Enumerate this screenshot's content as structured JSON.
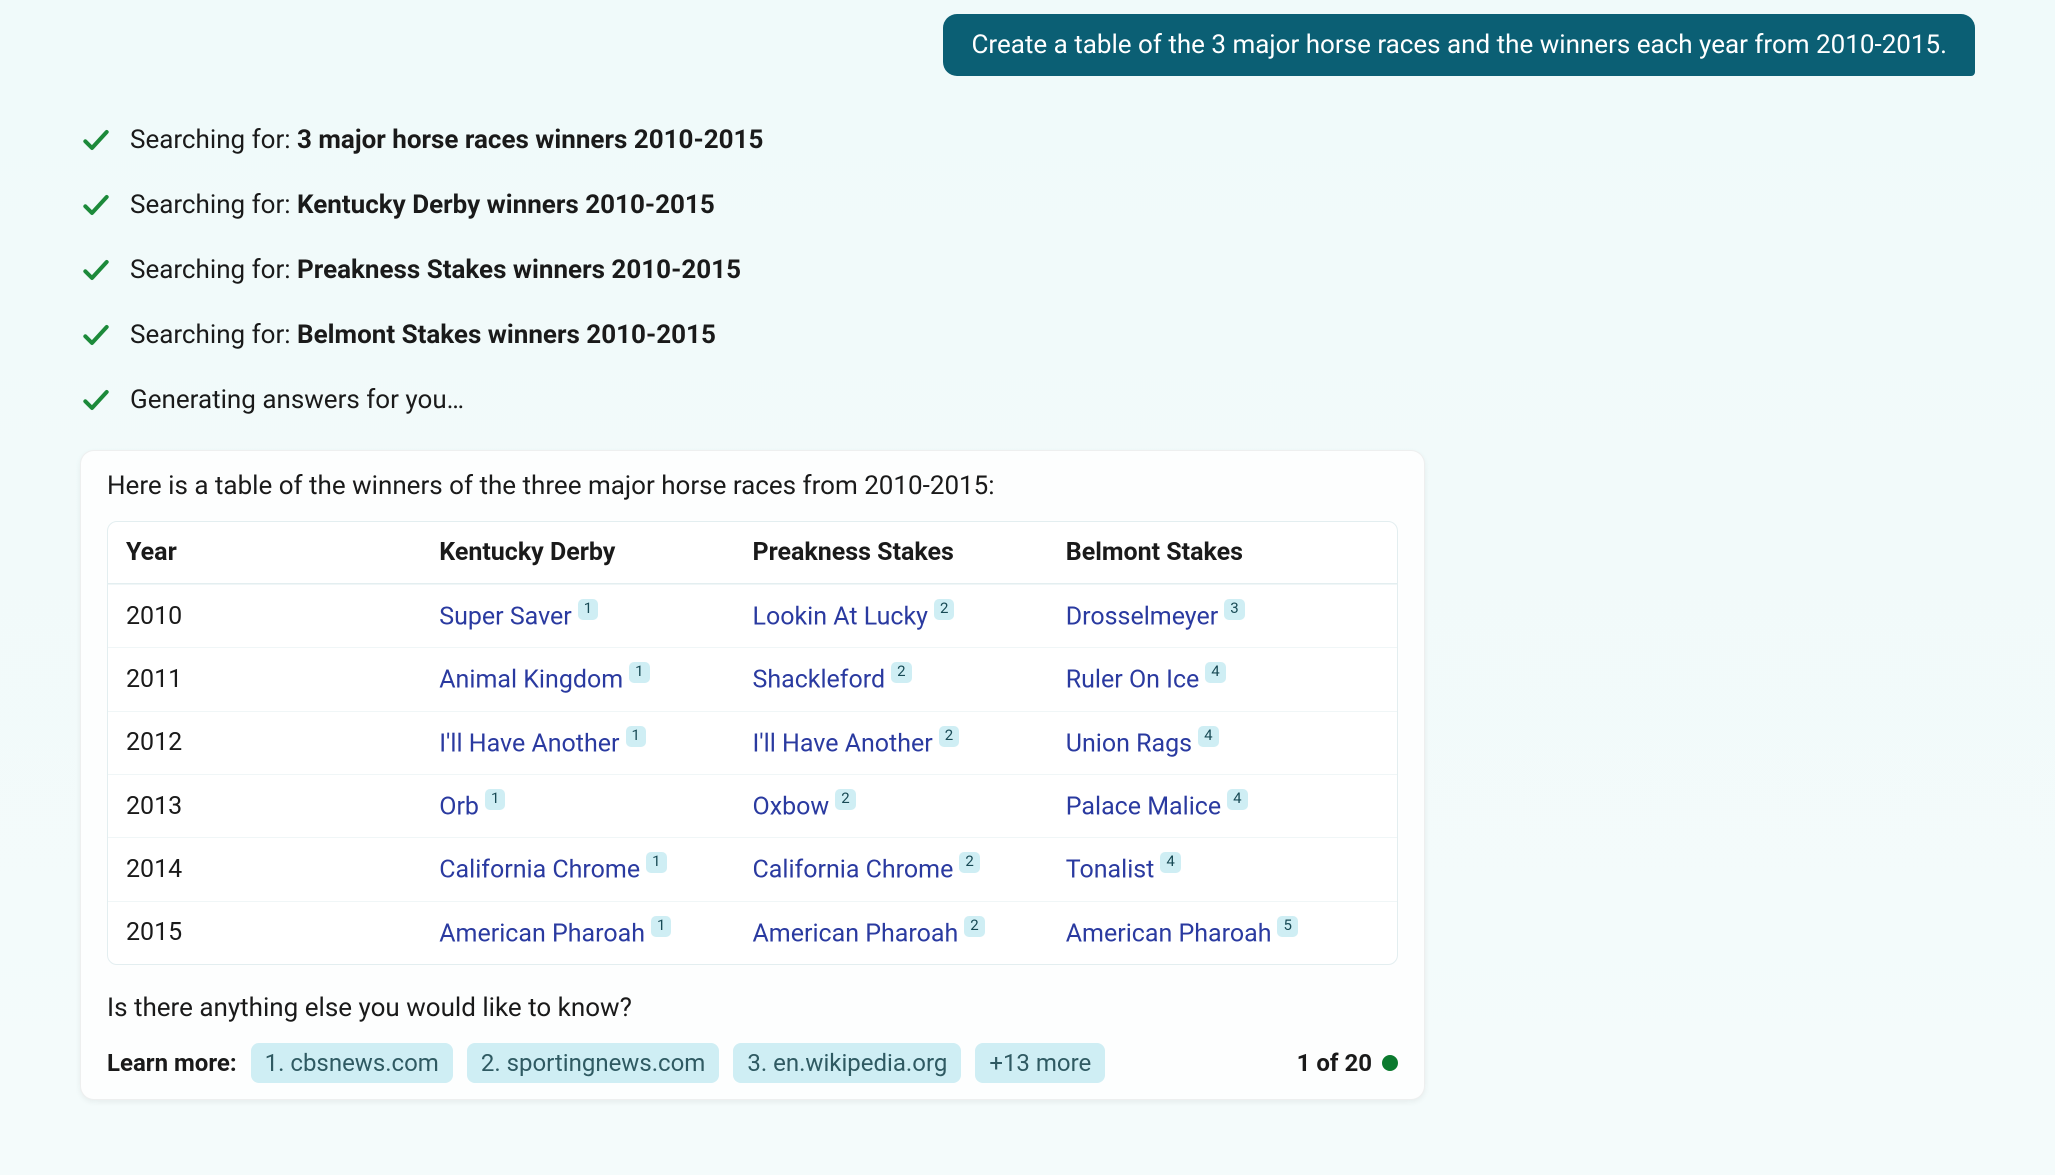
{
  "user_prompt": "Create a table of the 3 major horse races and the winners each year from 2010-2015.",
  "steps": [
    {
      "prefix": "Searching for: ",
      "query": "3 major horse races winners 2010-2015"
    },
    {
      "prefix": "Searching for: ",
      "query": "Kentucky Derby winners 2010-2015"
    },
    {
      "prefix": "Searching for: ",
      "query": "Preakness Stakes winners 2010-2015"
    },
    {
      "prefix": "Searching for: ",
      "query": "Belmont Stakes winners 2010-2015"
    },
    {
      "prefix": "",
      "query": "Generating answers for you…"
    }
  ],
  "answer_intro": "Here is a table of the winners of the three major horse races from 2010-2015:",
  "table": {
    "headers": [
      "Year",
      "Kentucky Derby",
      "Preakness Stakes",
      "Belmont Stakes"
    ],
    "rows": [
      {
        "year": "2010",
        "kd": {
          "name": "Super Saver",
          "cite": "1"
        },
        "ps": {
          "name": "Lookin At Lucky",
          "cite": "2"
        },
        "bs": {
          "name": "Drosselmeyer",
          "cite": "3"
        }
      },
      {
        "year": "2011",
        "kd": {
          "name": "Animal Kingdom",
          "cite": "1"
        },
        "ps": {
          "name": "Shackleford",
          "cite": "2"
        },
        "bs": {
          "name": "Ruler On Ice",
          "cite": "4"
        }
      },
      {
        "year": "2012",
        "kd": {
          "name": "I'll Have Another",
          "cite": "1"
        },
        "ps": {
          "name": "I'll Have Another",
          "cite": "2"
        },
        "bs": {
          "name": "Union Rags",
          "cite": "4"
        }
      },
      {
        "year": "2013",
        "kd": {
          "name": "Orb",
          "cite": "1"
        },
        "ps": {
          "name": "Oxbow",
          "cite": "2"
        },
        "bs": {
          "name": "Palace Malice",
          "cite": "4"
        }
      },
      {
        "year": "2014",
        "kd": {
          "name": "California Chrome",
          "cite": "1"
        },
        "ps": {
          "name": "California Chrome",
          "cite": "2"
        },
        "bs": {
          "name": "Tonalist",
          "cite": "4"
        }
      },
      {
        "year": "2015",
        "kd": {
          "name": "American Pharoah",
          "cite": "1"
        },
        "ps": {
          "name": "American Pharoah",
          "cite": "2"
        },
        "bs": {
          "name": "American Pharoah",
          "cite": "5"
        }
      }
    ]
  },
  "followup": "Is there anything else you would like to know?",
  "learn_more_label": "Learn more:",
  "learn_more": [
    "1. cbsnews.com",
    "2. sportingnews.com",
    "3. en.wikipedia.org",
    "+13 more"
  ],
  "counter": "1 of 20"
}
